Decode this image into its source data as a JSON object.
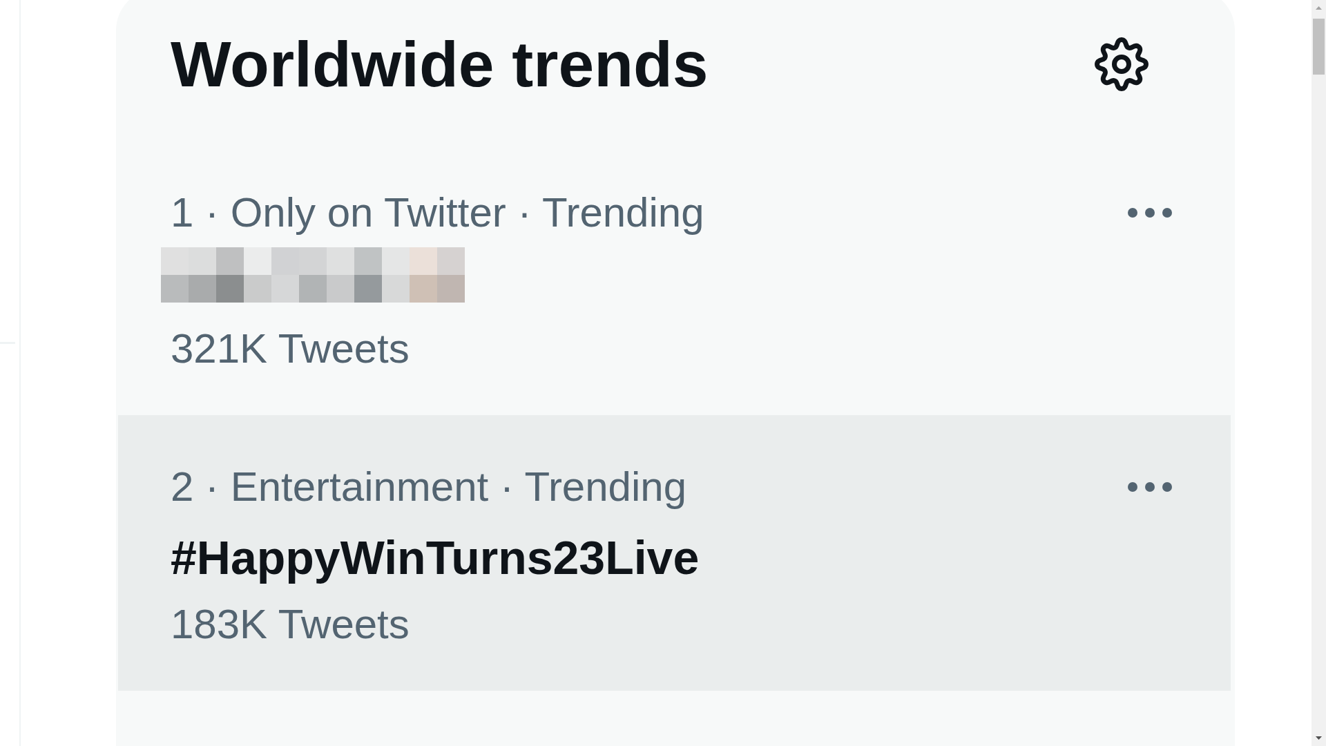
{
  "trends_panel": {
    "title": "Worldwide trends",
    "trends": [
      {
        "kind": "redacted",
        "meta": "1 · Only on Twitter · Trending",
        "count": "321K Tweets",
        "highlighted": false
      },
      {
        "kind": "hashtag",
        "meta": "2 · Entertainment · Trending",
        "name": "#HappyWinTurns23Live",
        "count": "183K Tweets",
        "highlighted": true
      }
    ]
  }
}
